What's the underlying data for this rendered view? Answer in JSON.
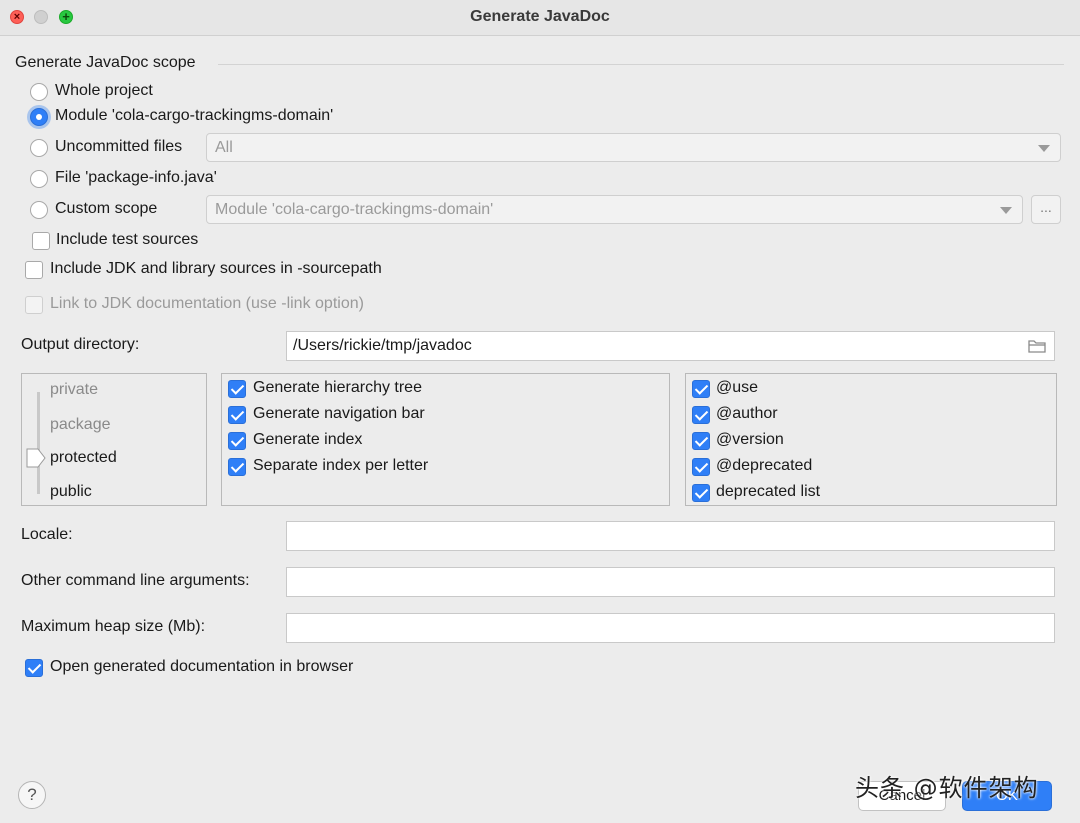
{
  "window": {
    "title": "Generate JavaDoc"
  },
  "scope": {
    "title": "Generate JavaDoc scope",
    "options": {
      "whole_project": "Whole project",
      "module": "Module 'cola-cargo-trackingms-domain'",
      "uncommitted": "Uncommitted files",
      "file": "File 'package-info.java'",
      "custom": "Custom scope"
    },
    "selected": "module",
    "uncommitted_combo": "All",
    "custom_combo": "Module 'cola-cargo-trackingms-domain'",
    "custom_browse": "...",
    "include_test_sources": "Include test sources"
  },
  "include_jdk": "Include JDK and library sources in -sourcepath",
  "link_jdk": "Link to JDK documentation (use -link option)",
  "output": {
    "label": "Output directory:",
    "value": "/Users/rickie/tmp/javadoc"
  },
  "visibility": {
    "levels": [
      "private",
      "package",
      "protected",
      "public"
    ],
    "selected": "protected"
  },
  "generate_options": [
    "Generate hierarchy tree",
    "Generate navigation bar",
    "Generate index",
    "Separate index per letter"
  ],
  "tag_options": [
    "@use",
    "@author",
    "@version",
    "@deprecated",
    "deprecated list"
  ],
  "locale": {
    "label": "Locale:",
    "value": ""
  },
  "other_args": {
    "label": "Other command line arguments:",
    "value": ""
  },
  "heap": {
    "label": "Maximum heap size (Mb):",
    "value": ""
  },
  "open_browser": "Open generated documentation in browser",
  "buttons": {
    "help": "?",
    "cancel": "Cancel",
    "ok": "OK"
  },
  "watermark": "头条 @软件架构",
  "colors": {
    "accent": "#2f7ff7",
    "close": "#fe5f57",
    "zoom": "#28c840"
  }
}
